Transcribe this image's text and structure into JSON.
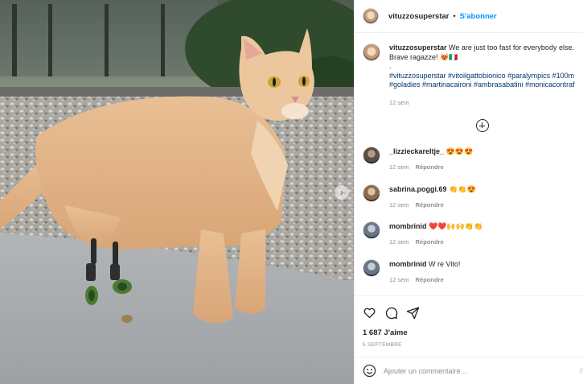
{
  "post": {
    "username": "vituzzosuperstar",
    "separator": "•",
    "follow_label": "S'abonner",
    "caption": {
      "username": "vituzzosuperstar",
      "text": "We are just too fast for everybody else.",
      "line2": "Brave ragazze! 😻🇮🇹",
      "line3": ".",
      "hashtags_line1": "#vituzzosuperstar #vitoilgattobionico #paralympics #100m",
      "hashtags_line2": "#goladies #martinacaironi #ambrasabatini #monicacontraf",
      "age": "12 sem"
    },
    "comments": [
      {
        "username": "_lizzieckareltje_",
        "text": "😍😍😍",
        "age": "12 sem",
        "reply_label": "Répondre"
      },
      {
        "username": "sabrina.poggi.69",
        "text": "👏👏😍",
        "age": "12 sem",
        "reply_label": "Répondre"
      },
      {
        "username": "mombrinid",
        "text": "❤️❤️🙌🙌👏👏",
        "age": "12 sem",
        "reply_label": "Répondre"
      },
      {
        "username": "mombrinid",
        "text": "W re Vito!",
        "age": "12 sem",
        "reply_label": "Répondre"
      }
    ],
    "likes_text": "1 687 J'aime",
    "date_text": "5 SEPTEMBRE",
    "comment_placeholder": "Ajouter un commentaire…",
    "publish_label": "P"
  },
  "colors": {
    "link_blue": "#0095f6",
    "hashtag_blue": "#00376b",
    "secondary_text": "#8e8e8e",
    "cat_fur": "#e6b689"
  },
  "icons": [
    "more-comments-plus-icon",
    "heart-icon",
    "comment-icon",
    "share-icon",
    "emoji-icon",
    "carousel-next-icon"
  ]
}
